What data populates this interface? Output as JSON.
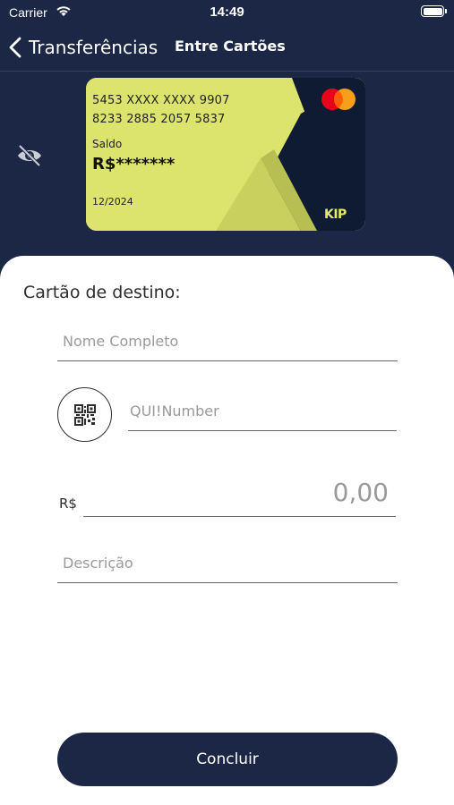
{
  "status_bar": {
    "carrier": "Carrier",
    "time": "14:49",
    "wifi_icon": "wifi-icon",
    "battery_icon": "battery-icon"
  },
  "nav": {
    "back_label": "Transferências",
    "title": "Entre Cartões",
    "back_icon": "chevron-left-icon"
  },
  "card": {
    "number_line1": "5453 XXXX XXXX 9907",
    "number_line2": "8233 2885 2057 5837",
    "balance_label": "Saldo",
    "balance_value": "R$*******",
    "expiry": "12/2024",
    "brand_logo": "KIP",
    "network": "mastercard",
    "visibility_icon": "eye-off-icon",
    "colors": {
      "card_bg": "#dce46e",
      "card_dark": "#0f1a33"
    }
  },
  "form": {
    "title": "Cartão de destino:",
    "name_placeholder": "Nome Completo",
    "qui_placeholder": "QUI!Number",
    "qr_icon": "qr-code-icon",
    "currency": "R$",
    "amount_placeholder": "0,00",
    "description_placeholder": "Descrição",
    "submit_label": "Concluir"
  },
  "colors": {
    "background": "#1b2744",
    "panel": "#ffffff",
    "button": "#1b2744"
  }
}
